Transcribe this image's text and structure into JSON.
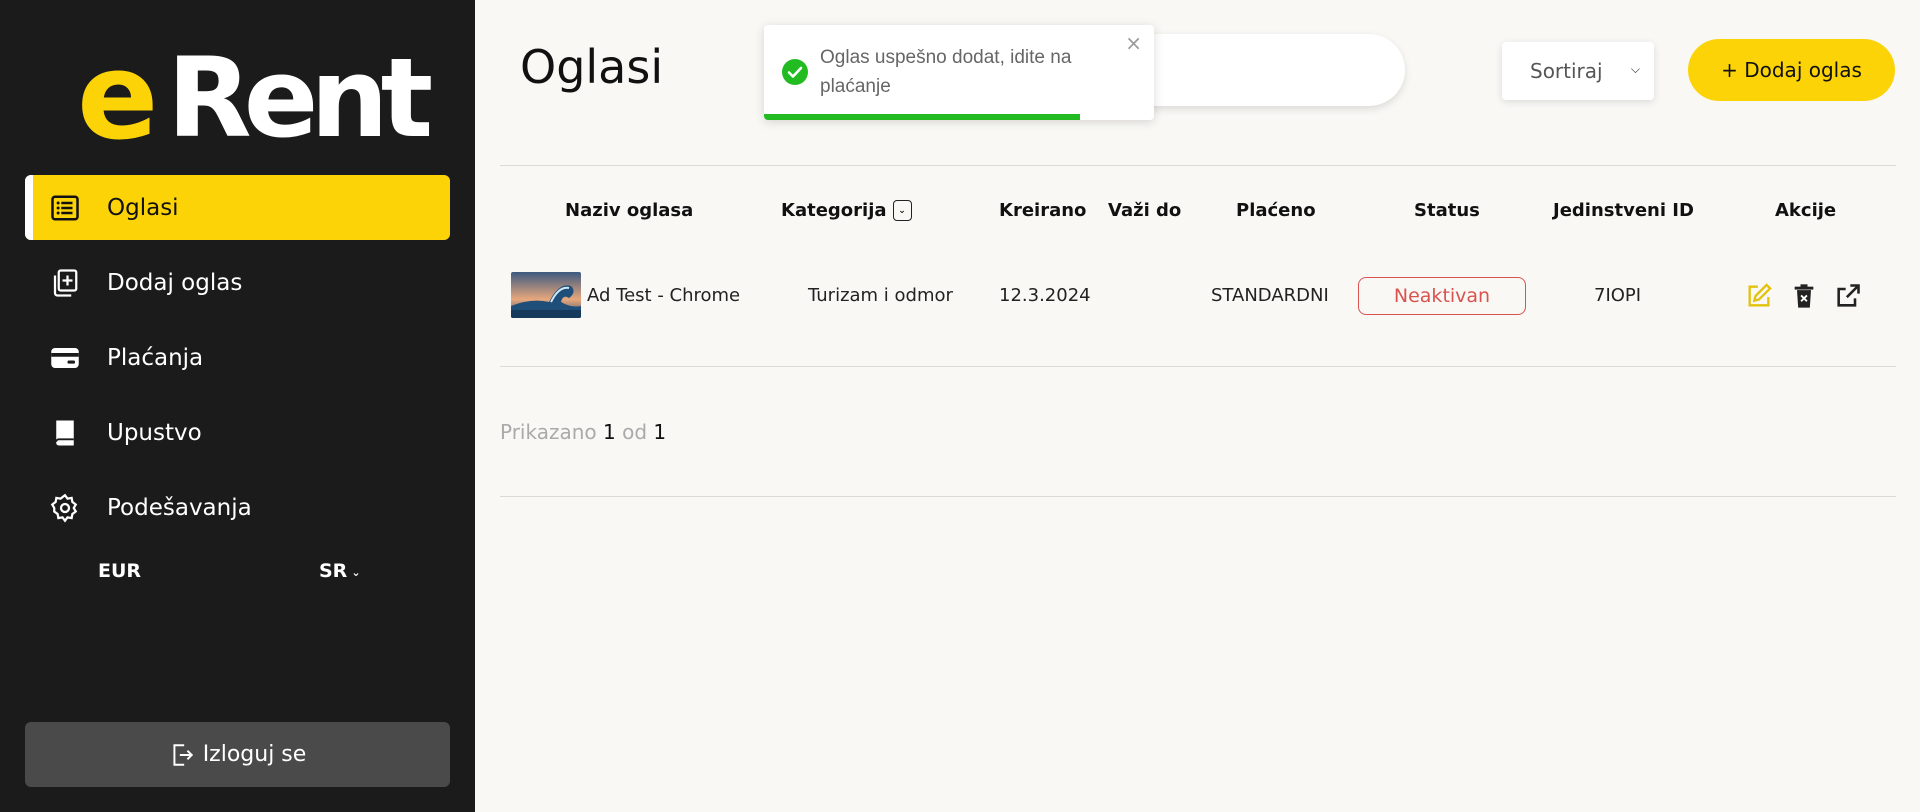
{
  "brand": {
    "logo_e": "e",
    "logo_rest": "Rent"
  },
  "sidebar": {
    "items": [
      {
        "label": "Oglasi",
        "icon": "list-icon",
        "active": true
      },
      {
        "label": "Dodaj oglas",
        "icon": "add-document-icon",
        "active": false
      },
      {
        "label": "Plaćanja",
        "icon": "credit-card-icon",
        "active": false
      },
      {
        "label": "Upustvo",
        "icon": "book-icon",
        "active": false
      },
      {
        "label": "Podešavanja",
        "icon": "gear-icon",
        "active": false
      }
    ],
    "currency": "EUR",
    "language": "SR",
    "logout_label": "Izloguj se"
  },
  "header": {
    "title": "Oglasi",
    "sort_label": "Sortiraj",
    "add_button": "+ Dodaj oglas",
    "search": {
      "value": ""
    }
  },
  "toast": {
    "message": "Oglas uspešno dodat, idite na plaćanje",
    "close": "×",
    "progress": 0.81,
    "color": "#22bb22"
  },
  "table": {
    "columns": [
      "Naziv oglasa",
      "Kategorija",
      "Kreirano",
      "Važi do",
      "Plaćeno",
      "Status",
      "Jedinstveni ID",
      "Akcije"
    ],
    "rows": [
      {
        "name": "Ad Test - Chrome",
        "category": "Turizam i odmor",
        "created": "12.3.2024",
        "valid_until": "",
        "paid": "STANDARDNI",
        "status": "Neaktivan",
        "uid": "7IOPI",
        "actions": [
          "edit-icon",
          "delete-icon",
          "external-link-icon"
        ]
      }
    ]
  },
  "pagination": {
    "prefix": "Prikazano",
    "current": "1",
    "sep": "od",
    "total": "1"
  },
  "colors": {
    "accent": "#fcd307",
    "sidebar_bg": "#1b1b1b",
    "status_inactive": "#d9534f",
    "success": "#22bb22"
  }
}
